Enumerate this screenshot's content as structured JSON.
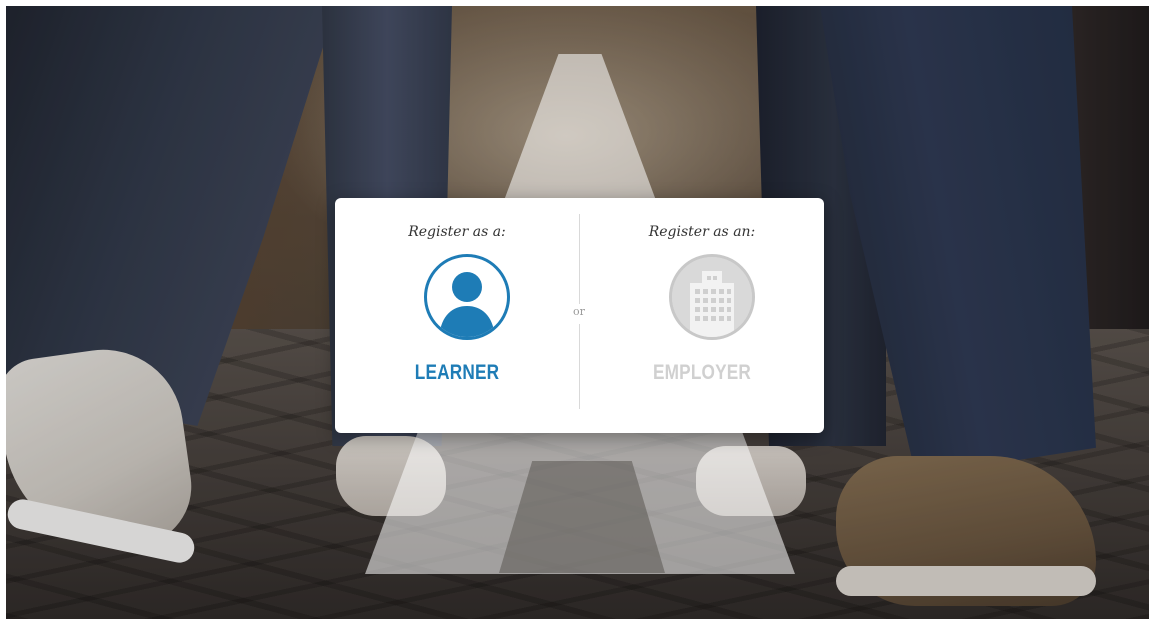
{
  "card": {
    "left": {
      "prompt": "Register as a:",
      "label": "LEARNER",
      "icon": "person-icon",
      "color": "#1e7cb6"
    },
    "or": "or",
    "right": {
      "prompt": "Register as an:",
      "label": "EMPLOYER",
      "icon": "building-icon",
      "color": "#cfcfcf"
    }
  }
}
